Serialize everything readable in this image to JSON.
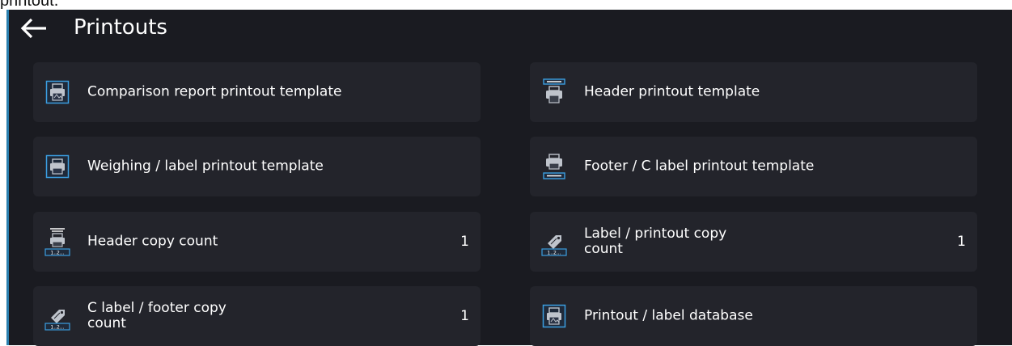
{
  "doc_fragment": "printout.",
  "header": {
    "title": "Printouts",
    "back_icon": "arrow-left-icon"
  },
  "tiles": [
    {
      "label": "Comparison report printout template",
      "icon": "printer-doc-icon",
      "value": ""
    },
    {
      "label": "Header printout template",
      "icon": "printer-header-icon",
      "value": ""
    },
    {
      "label": "Weighing / label printout template",
      "icon": "printer-icon",
      "value": ""
    },
    {
      "label": "Footer / C label printout template",
      "icon": "printer-footer-icon",
      "value": ""
    },
    {
      "label": "Header copy count",
      "icon": "printer-copy-count-icon",
      "value": "1"
    },
    {
      "label": "Label / printout copy count",
      "icon": "tag-copy-count-icon",
      "value": "1"
    },
    {
      "label": "C label / footer copy count",
      "icon": "tag-copy-count-icon",
      "value": "1"
    },
    {
      "label": "Printout / label database",
      "icon": "printer-doc-icon",
      "value": ""
    }
  ],
  "colors": {
    "background": "#1a1b21",
    "tile": "#23242b",
    "accent": "#2a7fae",
    "text": "#ffffff"
  }
}
